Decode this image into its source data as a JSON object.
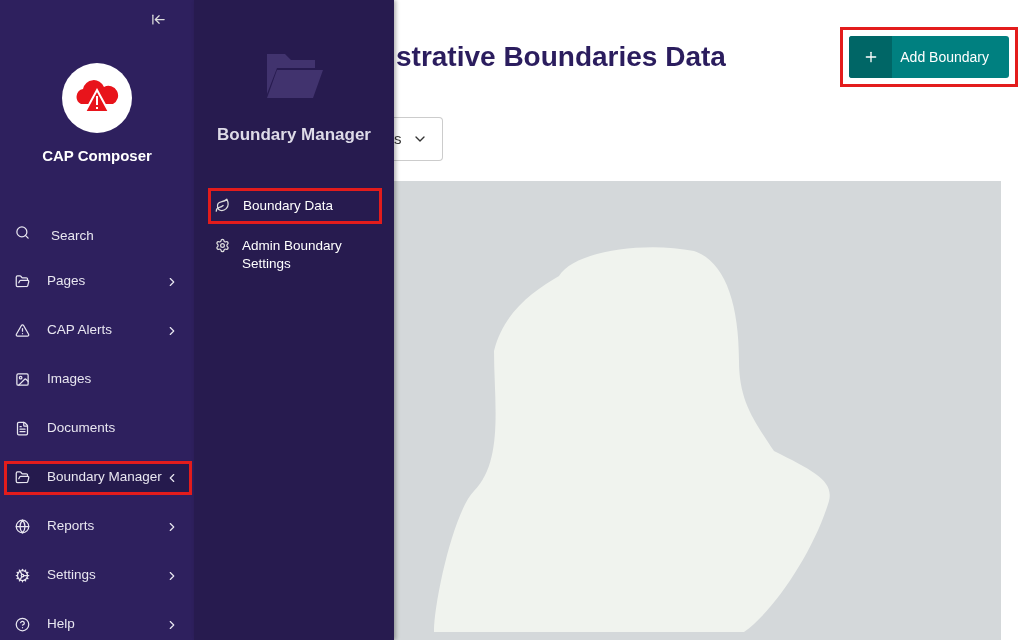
{
  "brand": {
    "name": "CAP Composer"
  },
  "nav": [
    {
      "label": "Search",
      "kind": "link",
      "expanded": false,
      "highlighted": false
    },
    {
      "label": "Pages",
      "kind": "submenu",
      "expanded": false,
      "highlighted": false
    },
    {
      "label": "CAP Alerts",
      "kind": "submenu",
      "expanded": false,
      "highlighted": false
    },
    {
      "label": "Images",
      "kind": "link",
      "expanded": false,
      "highlighted": false
    },
    {
      "label": "Documents",
      "kind": "link",
      "expanded": false,
      "highlighted": false
    },
    {
      "label": "Boundary Manager",
      "kind": "submenu",
      "expanded": true,
      "highlighted": true
    },
    {
      "label": "Reports",
      "kind": "submenu",
      "expanded": false,
      "highlighted": false
    },
    {
      "label": "Settings",
      "kind": "submenu",
      "expanded": false,
      "highlighted": false
    },
    {
      "label": "Help",
      "kind": "submenu",
      "expanded": false,
      "highlighted": false
    }
  ],
  "flyout": {
    "title": "Boundary Manager",
    "items": [
      {
        "label": "Boundary Data",
        "highlighted": true
      },
      {
        "label": "Admin Boundary Settings",
        "highlighted": false
      }
    ]
  },
  "main": {
    "title": "strative Boundaries Data",
    "add_button": {
      "label": "Add Boundary",
      "highlighted": true
    },
    "filter": {
      "value": "s"
    }
  }
}
